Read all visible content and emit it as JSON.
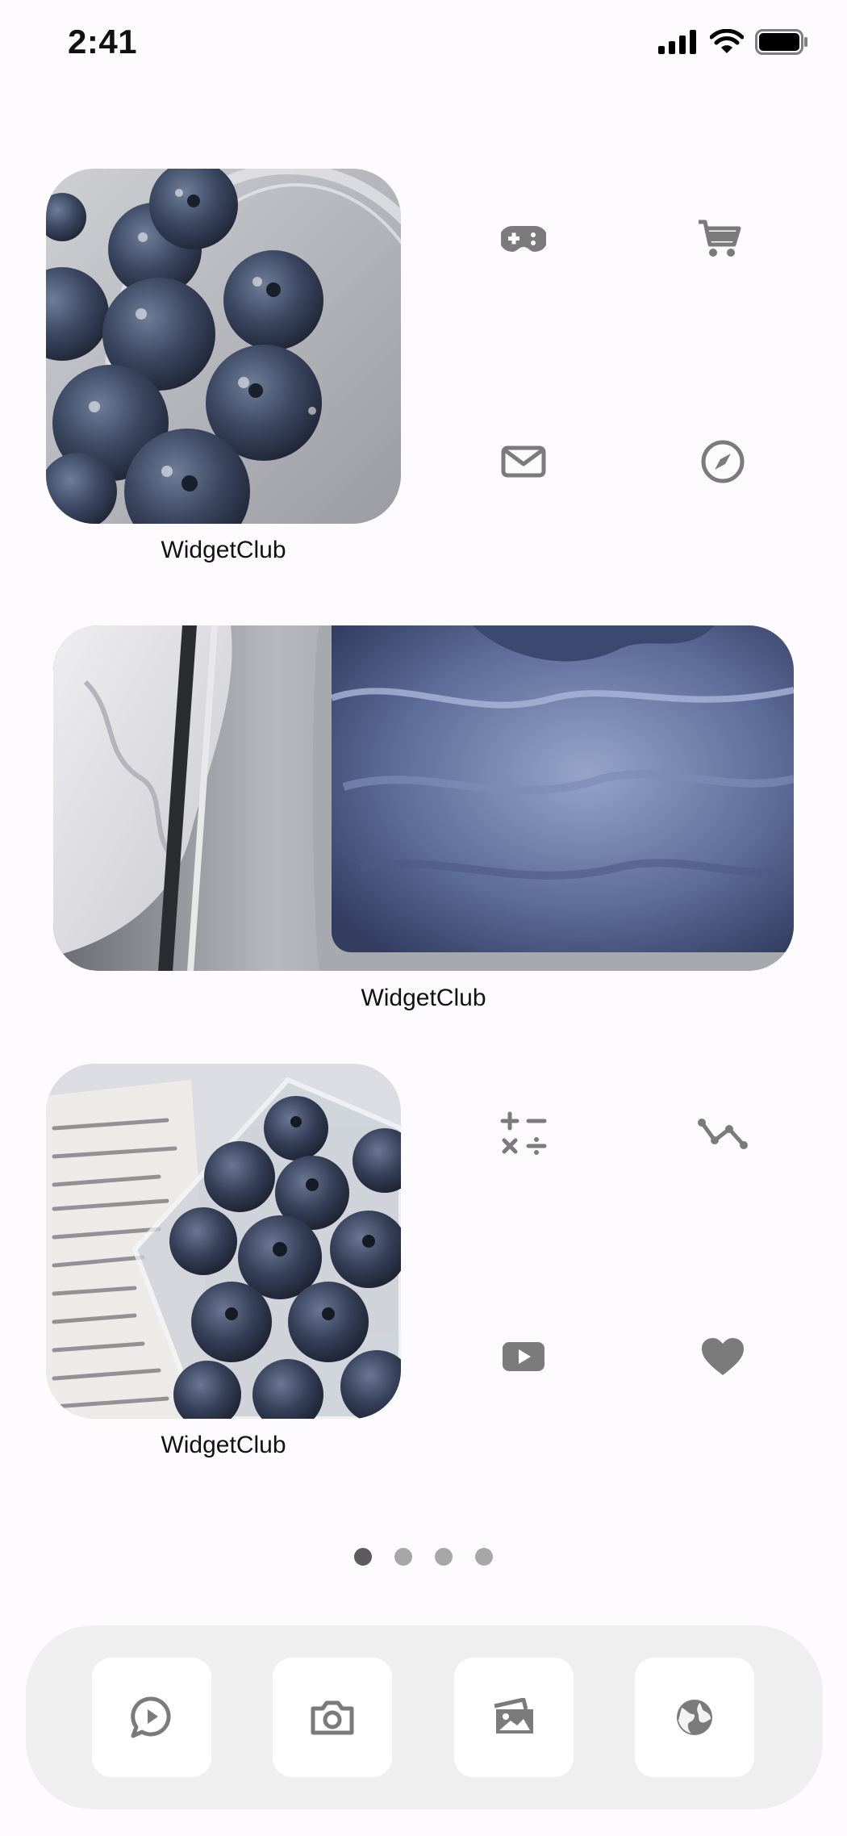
{
  "status_bar": {
    "time": "2:41"
  },
  "widgets": [
    {
      "label": "WidgetClub",
      "photo": "blueberries in glass of water"
    },
    {
      "label": "WidgetClub",
      "photo": "blueberry ice cream tub"
    },
    {
      "label": "WidgetClub",
      "photo": "blueberries on open book"
    }
  ],
  "icons": {
    "row1": [
      "gamepad-icon",
      "cart-icon",
      "mail-icon",
      "compass-icon"
    ],
    "row2": [
      "calculator-icon",
      "graph-icon",
      "youtube-icon",
      "heart-icon"
    ],
    "dock": [
      "message-icon",
      "camera-icon",
      "photos-icon",
      "globe-icon"
    ],
    "icon_color": "#7b7b7b"
  },
  "page_indicator": {
    "total": 4,
    "current": 1
  }
}
